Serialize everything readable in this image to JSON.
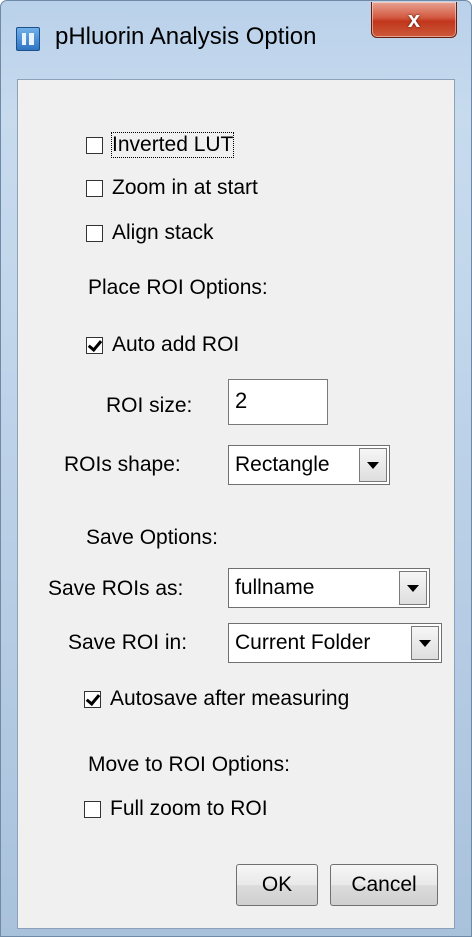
{
  "window": {
    "title": "pHluorin Analysis Option",
    "close_label": "x"
  },
  "checkboxes": {
    "inverted_lut": {
      "label": "Inverted LUT",
      "checked": false
    },
    "zoom_in_at_start": {
      "label": "Zoom in at start",
      "checked": false
    },
    "align_stack": {
      "label": "Align stack",
      "checked": false
    },
    "auto_add_roi": {
      "label": "Auto add ROI",
      "checked": true
    },
    "autosave_after_measuring": {
      "label": "Autosave after measuring",
      "checked": true
    },
    "full_zoom_to_roi": {
      "label": "Full zoom to ROI",
      "checked": false
    }
  },
  "sections": {
    "place_roi": "Place ROI Options:",
    "save": "Save Options:",
    "move_to_roi": "Move to ROI Options:"
  },
  "fields": {
    "roi_size": {
      "label": "ROI size:",
      "value": "2"
    },
    "rois_shape": {
      "label": "ROIs shape:",
      "value": "Rectangle"
    },
    "save_rois_as": {
      "label": "Save ROIs as:",
      "value": "fullname"
    },
    "save_roi_in": {
      "label": "Save ROI in:",
      "value": "Current Folder"
    }
  },
  "buttons": {
    "ok": "OK",
    "cancel": "Cancel"
  },
  "colors": {
    "frame": "#b9d1ea",
    "client": "#f0f0f0",
    "close": "#c1361c"
  }
}
